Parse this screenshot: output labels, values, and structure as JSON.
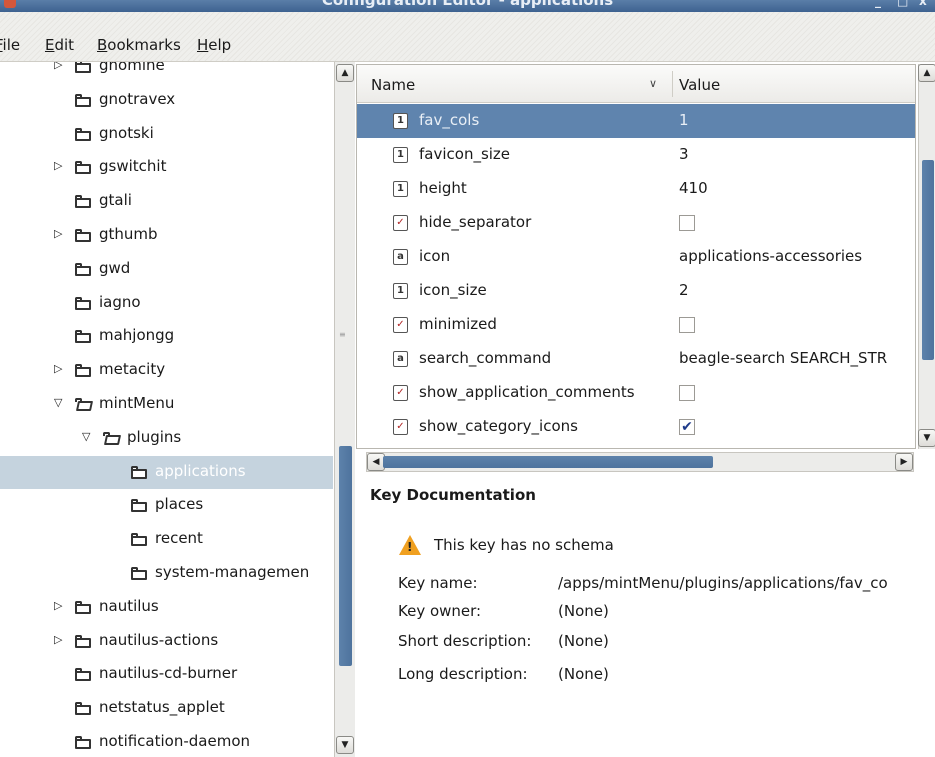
{
  "window": {
    "title": "Configuration Editor - applications",
    "controls": {
      "minimize": "_",
      "maximize": "□",
      "close": "x"
    }
  },
  "menubar": {
    "items": [
      {
        "label": "File",
        "mnemonic": "F"
      },
      {
        "label": "Edit",
        "mnemonic": "E"
      },
      {
        "label": "Bookmarks",
        "mnemonic": "B"
      },
      {
        "label": "Help",
        "mnemonic": "H"
      }
    ]
  },
  "tree": {
    "items": [
      {
        "label": "gnomine",
        "expander": "collapsed",
        "state": "closed"
      },
      {
        "label": "gnotravex",
        "expander": "none",
        "state": "closed"
      },
      {
        "label": "gnotski",
        "expander": "none",
        "state": "closed"
      },
      {
        "label": "gswitchit",
        "expander": "collapsed",
        "state": "closed"
      },
      {
        "label": "gtali",
        "expander": "none",
        "state": "closed"
      },
      {
        "label": "gthumb",
        "expander": "collapsed",
        "state": "closed"
      },
      {
        "label": "gwd",
        "expander": "none",
        "state": "closed"
      },
      {
        "label": "iagno",
        "expander": "none",
        "state": "closed"
      },
      {
        "label": "mahjongg",
        "expander": "none",
        "state": "closed"
      },
      {
        "label": "metacity",
        "expander": "collapsed",
        "state": "closed"
      },
      {
        "label": "mintMenu",
        "expander": "expanded",
        "state": "open"
      },
      {
        "label": "plugins",
        "expander": "expanded",
        "state": "open"
      },
      {
        "label": "applications",
        "expander": "none",
        "state": "closed",
        "selected": true
      },
      {
        "label": "places",
        "expander": "none",
        "state": "closed"
      },
      {
        "label": "recent",
        "expander": "none",
        "state": "closed"
      },
      {
        "label": "system-managemen",
        "expander": "none",
        "state": "closed"
      },
      {
        "label": "nautilus",
        "expander": "collapsed",
        "state": "closed"
      },
      {
        "label": "nautilus-actions",
        "expander": "collapsed",
        "state": "closed"
      },
      {
        "label": "nautilus-cd-burner",
        "expander": "none",
        "state": "closed"
      },
      {
        "label": "netstatus_applet",
        "expander": "none",
        "state": "closed"
      },
      {
        "label": "notification-daemon",
        "expander": "none",
        "state": "closed"
      }
    ]
  },
  "keys": {
    "columns": {
      "name": "Name",
      "value": "Value",
      "sort_indicator": "∨"
    },
    "rows": [
      {
        "name": "fav_cols",
        "type": "int",
        "type_glyph": "1",
        "value": "1",
        "selected": true
      },
      {
        "name": "favicon_size",
        "type": "int",
        "type_glyph": "1",
        "value": "3"
      },
      {
        "name": "height",
        "type": "int",
        "type_glyph": "1",
        "value": "410"
      },
      {
        "name": "hide_separator",
        "type": "bool",
        "type_glyph": "✓",
        "checked": false
      },
      {
        "name": "icon",
        "type": "string",
        "type_glyph": "a",
        "value": "applications-accessories"
      },
      {
        "name": "icon_size",
        "type": "int",
        "type_glyph": "1",
        "value": "2"
      },
      {
        "name": "minimized",
        "type": "bool",
        "type_glyph": "✓",
        "checked": false
      },
      {
        "name": "search_command",
        "type": "string",
        "type_glyph": "a",
        "value": "beagle-search SEARCH_STR"
      },
      {
        "name": "show_application_comments",
        "type": "bool",
        "type_glyph": "✓",
        "checked": false
      },
      {
        "name": "show_category_icons",
        "type": "bool",
        "type_glyph": "✓",
        "checked": true
      }
    ]
  },
  "documentation": {
    "title": "Key Documentation",
    "warning": "This key has no schema",
    "fields": [
      {
        "label": "Key name:",
        "value": "/apps/mintMenu/plugins/applications/fav_co"
      },
      {
        "label": "Key owner:",
        "value": "(None)"
      },
      {
        "label": "Short description:",
        "value": "(None)"
      },
      {
        "label": "Long description:",
        "value": "(None)"
      }
    ]
  },
  "icons": {
    "scroll_up": "▲",
    "scroll_down": "▼",
    "scroll_left": "◀",
    "scroll_right": "▶",
    "expander_collapsed": "▷",
    "expander_expanded": "▽",
    "warning": "!",
    "checkmark": "✔"
  },
  "colors": {
    "selection_list": "#5f84ae",
    "selection_tree": "#c5d3de",
    "scrollbar_thumb": "#5378a2",
    "warning": "#f0a020"
  }
}
